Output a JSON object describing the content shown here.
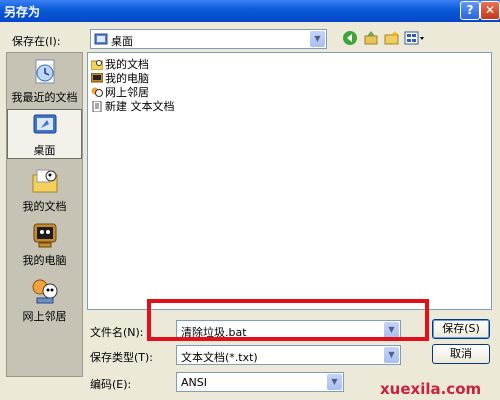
{
  "window": {
    "title": "另存为",
    "help_glyph": "?",
    "close_glyph": "✕"
  },
  "toolbar": {
    "save_in_label": "保存在(I):",
    "location": "桌面",
    "back_glyph": "◀",
    "up_glyph": "⇧",
    "new_folder_glyph": "✱",
    "views_glyph": "▦▾"
  },
  "places": [
    {
      "label": "我最近的文档",
      "icon": "recent-documents-icon"
    },
    {
      "label": "桌面",
      "icon": "desktop-icon",
      "selected": true
    },
    {
      "label": "我的文档",
      "icon": "my-documents-icon"
    },
    {
      "label": "我的电脑",
      "icon": "my-computer-icon"
    },
    {
      "label": "网上邻居",
      "icon": "network-places-icon"
    }
  ],
  "files": [
    {
      "name": "我的文档",
      "icon": "my-documents-icon"
    },
    {
      "name": "我的电脑",
      "icon": "my-computer-icon"
    },
    {
      "name": "网上邻居",
      "icon": "network-places-icon"
    },
    {
      "name": "新建 文本文档",
      "icon": "text-document-icon"
    }
  ],
  "form": {
    "filename_label": "文件名(N):",
    "filename_value": "清除垃圾.bat",
    "type_label": "保存类型(T):",
    "type_value": "文本文档(*.txt)",
    "encoding_label": "编码(E):",
    "encoding_value": "ANSI"
  },
  "buttons": {
    "save": "保存(S)",
    "cancel": "取消"
  },
  "watermark": "xuexila.com",
  "colors": {
    "annotation": "#e2101a",
    "titlebar": "#0a5ad8"
  }
}
